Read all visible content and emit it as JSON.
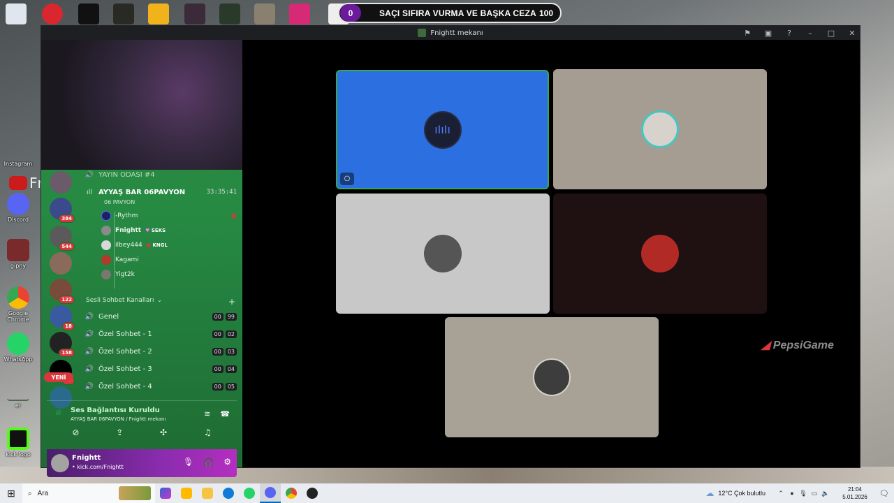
{
  "overlay": {
    "left_value": "0",
    "title": "SAÇI SIFIRA VURMA VE BAŞKA CEZA",
    "right_value": "100"
  },
  "desktop_icons": [
    {
      "label": "Instagram",
      "color": "#c13584"
    },
    {
      "label": "Discord",
      "color": "#5865f2"
    },
    {
      "label": "giphy",
      "color": "#7a2a2a"
    },
    {
      "label": "Google Chrome",
      "color": "#e8eaed"
    },
    {
      "label": "WhatsApp",
      "color": "#25d366"
    },
    {
      "label": "er",
      "color": "#4a6b4a"
    },
    {
      "label": "kick logo",
      "color": "#53fc18"
    }
  ],
  "desktop_partial_label": "Fnig",
  "window": {
    "title": "Fnightt mekanı"
  },
  "guild_badges": [
    "384",
    "544",
    "122",
    "18",
    "158",
    "47"
  ],
  "yeni_label": "YENİ",
  "channels": {
    "yayin": "YAYIN ODASI #4",
    "active": {
      "name": "AYYAŞ BAR 06PAVYON",
      "time": "33:35:41",
      "sub": "06 PAVYON"
    },
    "members": [
      {
        "name": "-Rythm",
        "tag": "",
        "avatar_color": "#1e1f6b"
      },
      {
        "name": "Fnightt",
        "tag": "SEKS",
        "avatar_color": "#8a8a88"
      },
      {
        "name": "ilbey444",
        "tag": "KNGL",
        "avatar_color": "#d8d8d8"
      },
      {
        "name": "Kagami",
        "tag": "",
        "avatar_color": "#b33a2a"
      },
      {
        "name": "Yigt2k",
        "tag": "",
        "avatar_color": "#7a7670"
      }
    ],
    "category": "Sesli Sohbet Kanalları",
    "voice": [
      {
        "name": "Genel",
        "a": "00",
        "b": "99"
      },
      {
        "name": "Özel Sohbet - 1",
        "a": "00",
        "b": "02"
      },
      {
        "name": "Özel Sohbet - 2",
        "a": "00",
        "b": "03"
      },
      {
        "name": "Özel Sohbet - 3",
        "a": "00",
        "b": "04"
      },
      {
        "name": "Özel Sohbet - 4",
        "a": "00",
        "b": "05"
      }
    ]
  },
  "voice_panel": {
    "status": "Ses Bağlantısı Kuruldu",
    "location": "AYYAŞ BAR 06PAVYON / Fnightt mekanı"
  },
  "user": {
    "name": "Fnightt",
    "status": "• kick.com/Fnightt"
  },
  "tiles": [
    {
      "bg": "#2b6fe0",
      "avatar": "#1b1f33",
      "speaking": true
    },
    {
      "bg": "#a69d92",
      "avatar": "#d7d2cc"
    },
    {
      "bg": "#c8c8c8",
      "avatar": "#555555"
    },
    {
      "bg": "#1f1012",
      "avatar": "#b22a25"
    },
    {
      "bg": "#a8a296",
      "avatar": "#3d3d3d"
    }
  ],
  "watermark": "PepsiGame",
  "taskbar": {
    "search_placeholder": "Ara",
    "weather": "12°C  Çok bulutlu",
    "time": "21:04",
    "date": "5.01.2026"
  },
  "colors": {
    "accent_green": "#23a55a",
    "discord_blurple": "#5865f2",
    "danger": "#da373c"
  }
}
